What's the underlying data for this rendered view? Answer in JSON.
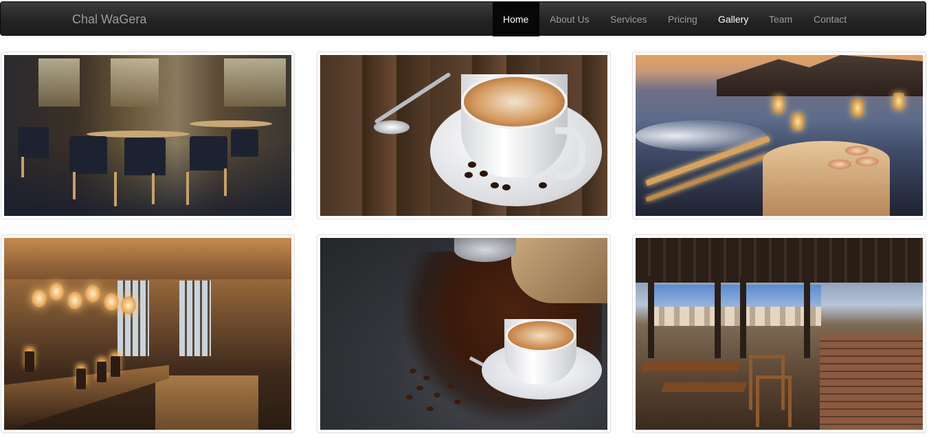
{
  "navbar": {
    "brand": "Chal WaGera",
    "items": [
      {
        "label": "Home",
        "state": "active"
      },
      {
        "label": "About Us",
        "state": "normal"
      },
      {
        "label": "Services",
        "state": "normal"
      },
      {
        "label": "Pricing",
        "state": "normal"
      },
      {
        "label": "Gallery",
        "state": "highlight"
      },
      {
        "label": "Team",
        "state": "normal"
      },
      {
        "label": "Contact",
        "state": "normal"
      }
    ]
  },
  "gallery": {
    "images": [
      {
        "subject": "restaurant-interior-photo"
      },
      {
        "subject": "latte-art-cup-photo"
      },
      {
        "subject": "beach-dinner-photo"
      },
      {
        "subject": "warm-lit-restaurant-photo"
      },
      {
        "subject": "coffee-beans-cup-photo"
      },
      {
        "subject": "terrace-restaurant-photo"
      }
    ]
  },
  "colors": {
    "navbar_bg": "#222222",
    "nav_text": "#9d9d9d",
    "nav_active_bg": "#080808",
    "nav_active_text": "#ffffff",
    "thumbnail_border": "#dddddd"
  }
}
